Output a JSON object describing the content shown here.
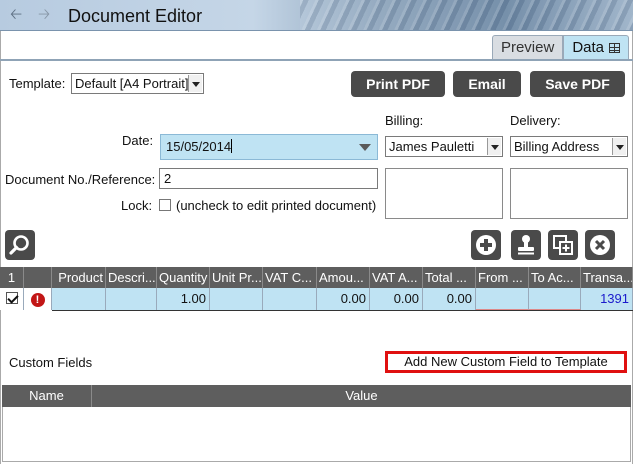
{
  "app": {
    "title": "Document Editor"
  },
  "tabs": {
    "preview": "Preview",
    "data": "Data"
  },
  "template": {
    "label": "Template:",
    "value": "Default [A4 Portrait]"
  },
  "actions": {
    "print_pdf": "Print PDF",
    "email": "Email",
    "save_pdf": "Save PDF"
  },
  "form": {
    "date_label": "Date:",
    "date_value": "15/05/2014",
    "docno_label": "Document No./Reference:",
    "docno_value": "2",
    "lock_label": "Lock:",
    "lock_hint": "(uncheck to edit printed document)"
  },
  "billing": {
    "label": "Billing:",
    "value": "James Pauletti"
  },
  "delivery": {
    "label": "Delivery:",
    "value": "Billing Address"
  },
  "grid": {
    "columns": [
      "1",
      "",
      "Product",
      "Descri...",
      "Quantity",
      "Unit Pr...",
      "VAT C...",
      "Amou...",
      "VAT A...",
      "Total ...",
      "From ...",
      "To Ac...",
      "Transa..."
    ],
    "row": {
      "quantity": "1.00",
      "amount": "0.00",
      "vat_amount": "0.00",
      "total": "0.00",
      "transaction": "1391"
    }
  },
  "custom_fields": {
    "label": "Custom Fields",
    "add_button": "Add New Custom Field to Template",
    "col_name": "Name",
    "col_value": "Value"
  },
  "colors": {
    "selection": "#bfe3f3",
    "button_dark": "#4a4a4a",
    "highlight_red": "#e01010",
    "link_blue": "#1a1acc"
  }
}
